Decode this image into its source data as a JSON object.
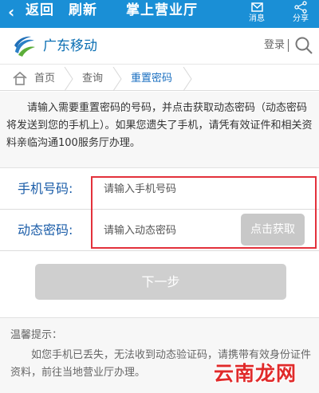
{
  "topbar": {
    "back_label": "返回",
    "refresh_label": "刷新",
    "title": "掌上营业厅",
    "message_label": "消息",
    "share_label": "分享"
  },
  "brand": {
    "name": "广东移动",
    "login_label": "登录"
  },
  "breadcrumb": {
    "items": [
      "首页",
      "查询",
      "重置密码"
    ]
  },
  "notice": "请输入需要重置密码的号码，并点击获取动态密码（动态密码将发送到您的手机上）。如果您遗失了手机，请凭有效证件和相关资料亲临沟通100服务厅办理。",
  "form": {
    "phone_label": "手机号码:",
    "phone_placeholder": "请输入手机号码",
    "code_label": "动态密码:",
    "code_placeholder": "请输入动态密码",
    "get_code_label": "点击获取",
    "next_label": "下一步"
  },
  "tips": {
    "heading": "温馨提示：",
    "body": "如您手机已丢失，无法收到动态验证码，请携带有效身份证件资料，前往当地营业厅办理。"
  },
  "watermark": "云南龙网",
  "colors": {
    "topbar": "#1a8fd6",
    "brand": "#0b6fb3",
    "highlight": "#e3313b"
  }
}
